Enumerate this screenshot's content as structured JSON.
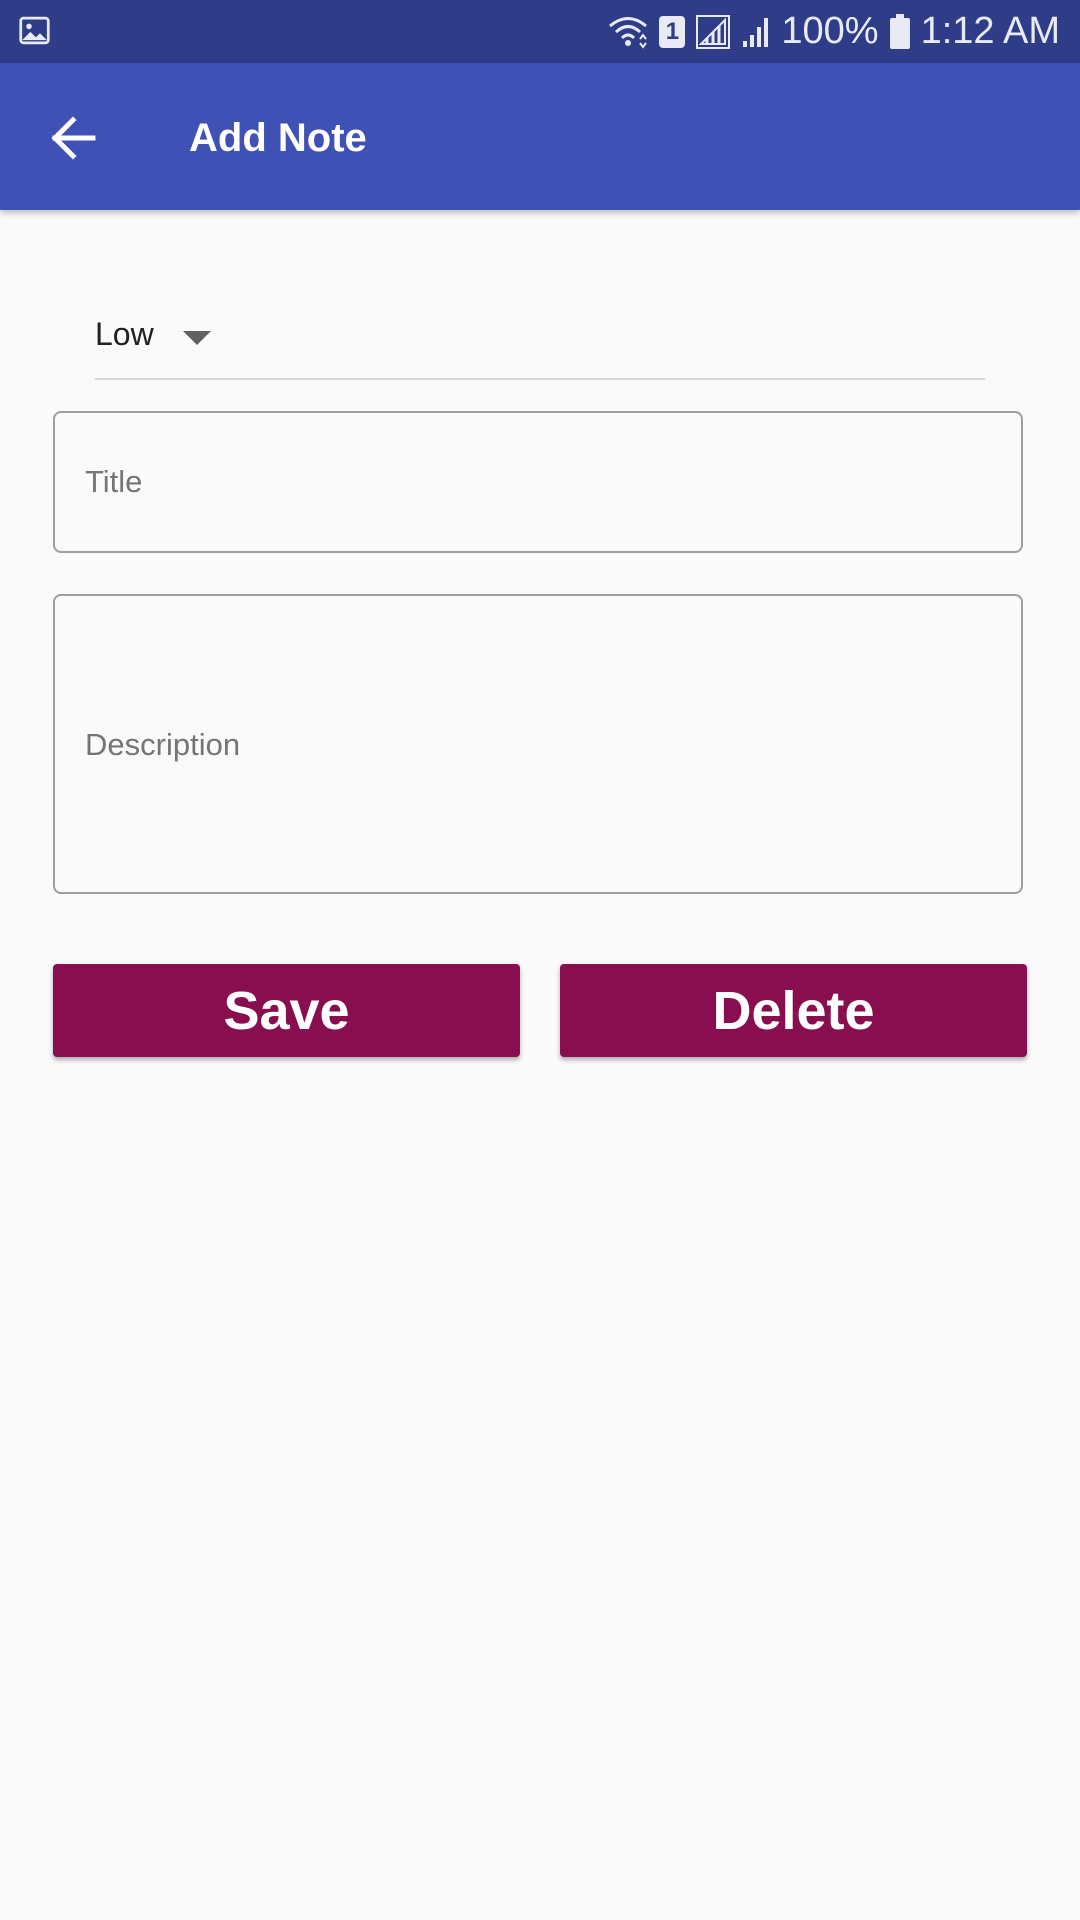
{
  "status_bar": {
    "battery": "100%",
    "time": "1:12 AM",
    "sim_slot": "1",
    "icons": [
      "gallery-icon",
      "wifi-icon",
      "sim-icon",
      "no-signal-icon",
      "signal-icon",
      "battery-icon"
    ]
  },
  "app_bar": {
    "title": "Add Note",
    "back_icon": "arrow-left-icon",
    "color": "#3f51b5"
  },
  "form": {
    "priority": {
      "selected": "Low"
    },
    "title_field": {
      "value": "",
      "placeholder": "Title"
    },
    "description_field": {
      "value": "",
      "placeholder": "Description"
    },
    "buttons": {
      "save_label": "Save",
      "delete_label": "Delete",
      "color": "#880e4f"
    }
  }
}
